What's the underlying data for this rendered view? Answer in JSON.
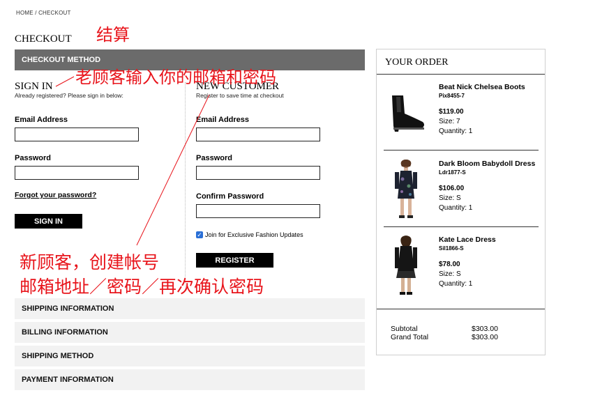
{
  "breadcrumb": "HOME  / CHECKOUT",
  "page_title": "CHECKOUT",
  "annotations": {
    "title_note": "结算",
    "signin_note": "老顾客输入你的邮箱和密码",
    "new_note_line1": "新顾客，创建帐号",
    "new_note_line2": "邮箱地址／密码／再次确认密码"
  },
  "checkout_method": {
    "label": "CHECKOUT METHOD"
  },
  "sign_in": {
    "title": "SIGN IN",
    "subtitle": "Already registered? Please sign in below:",
    "email_label": "Email Address",
    "email_value": "",
    "password_label": "Password",
    "password_value": "",
    "forgot_link": "Forgot your password?",
    "button_label": "SIGN IN"
  },
  "new_customer": {
    "title": "NEW CUSTOMER",
    "subtitle": "Register to save time at checkout",
    "email_label": "Email Address",
    "email_value": "",
    "password_label": "Password",
    "password_value": "",
    "confirm_label": "Confirm Password",
    "confirm_value": "",
    "newsletter_label": "Join for Exclusive Fashion Updates",
    "newsletter_checked": true,
    "button_label": "REGISTER"
  },
  "sections": [
    {
      "label": "SHIPPING INFORMATION"
    },
    {
      "label": "BILLING INFORMATION"
    },
    {
      "label": "SHIPPING METHOD"
    },
    {
      "label": "PAYMENT INFORMATION"
    }
  ],
  "order": {
    "title": "YOUR ORDER",
    "items": [
      {
        "name": "Beat Nick Chelsea Boots",
        "sku": "Pix8455-7",
        "price": "$119.00",
        "size": "Size: 7",
        "quantity": "Quantity: 1",
        "image": "boot-image"
      },
      {
        "name": "Dark Bloom Babydoll Dress",
        "sku": "Ldr1877-S",
        "price": "$106.00",
        "size": "Size: S",
        "quantity": "Quantity: 1",
        "image": "dress-image"
      },
      {
        "name": "Kate Lace Dress",
        "sku": "Sil1866-S",
        "price": "$78.00",
        "size": "Size: S",
        "quantity": "Quantity: 1",
        "image": "lace-dress-image"
      }
    ],
    "subtotal_label": "Subtotal",
    "subtotal_value": "$303.00",
    "grand_total_label": "Grand Total",
    "grand_total_value": "$303.00"
  },
  "colors": {
    "annotation_red": "#e8141b",
    "method_bar": "#6b6b6b",
    "section_bar": "#f2f2f2",
    "checkbox_blue": "#2a6fd6"
  }
}
